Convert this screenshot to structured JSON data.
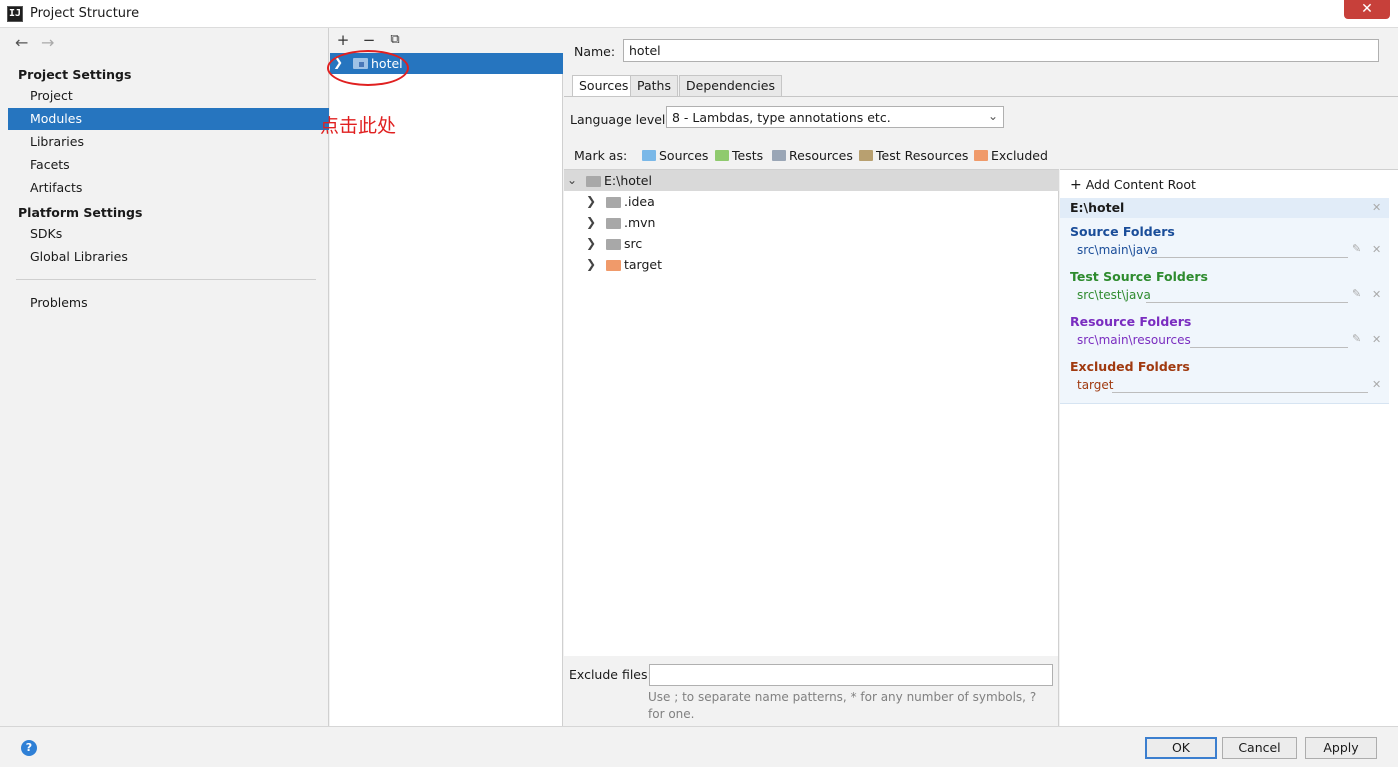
{
  "window": {
    "title": "Project Structure",
    "app_icon": "IJ",
    "close_glyph": "✕"
  },
  "nav": {
    "back_icon": "←",
    "forward_icon": "→",
    "project_settings_header": "Project Settings",
    "project_items": [
      "Project",
      "Modules",
      "Libraries",
      "Facets",
      "Artifacts"
    ],
    "selected": "Modules",
    "platform_settings_header": "Platform Settings",
    "platform_items": [
      "SDKs",
      "Global Libraries"
    ],
    "problems": "Problems"
  },
  "modules": {
    "toolbar": {
      "add": "+",
      "remove": "−",
      "copy": "⧉"
    },
    "items": [
      {
        "label": "hotel"
      }
    ],
    "annotation": "点击此处",
    "annotation_color": "#e02020"
  },
  "details": {
    "name_label": "Name:",
    "name_value": "hotel",
    "tabs": [
      "Sources",
      "Paths",
      "Dependencies"
    ],
    "active_tab": "Sources",
    "language_label": "Language level:",
    "language_value": "8 - Lambdas, type annotations etc.",
    "mark_as_label": "Mark as:",
    "mark_as": [
      {
        "label": "Sources",
        "color": "#7ab8e8"
      },
      {
        "label": "Tests",
        "color": "#8fca6e"
      },
      {
        "label": "Resources",
        "color": "#9aa6b6"
      },
      {
        "label": "Test Resources",
        "color": "#b8a070"
      },
      {
        "label": "Excluded",
        "color": "#f09a6a"
      }
    ],
    "tree": {
      "root": "E:\\hotel",
      "children": [
        {
          "label": ".idea",
          "color": "#a8a8a8"
        },
        {
          "label": ".mvn",
          "color": "#a8a8a8"
        },
        {
          "label": "src",
          "color": "#a8a8a8"
        },
        {
          "label": "target",
          "color": "#f09a6a"
        }
      ]
    },
    "exclude_label": "Exclude files:",
    "exclude_value": "",
    "exclude_hint": "Use ; to separate name patterns, * for any number of symbols, ? for one."
  },
  "content_roots": {
    "add_label": "Add Content Root",
    "root_path": "E:\\hotel",
    "groups": [
      {
        "title": "Source Folders",
        "path": "src\\main\\java",
        "color": "#1a4d99",
        "editable": true
      },
      {
        "title": "Test Source Folders",
        "path": "src\\test\\java",
        "color": "#2e8b2e",
        "editable": true
      },
      {
        "title": "Resource Folders",
        "path": "src\\main\\resources",
        "color": "#7a2dc0",
        "editable": true
      },
      {
        "title": "Excluded Folders",
        "path": "target",
        "color": "#a03a10",
        "editable": false
      }
    ]
  },
  "buttons": {
    "help": "?",
    "ok": "OK",
    "cancel": "Cancel",
    "apply": "Apply"
  }
}
